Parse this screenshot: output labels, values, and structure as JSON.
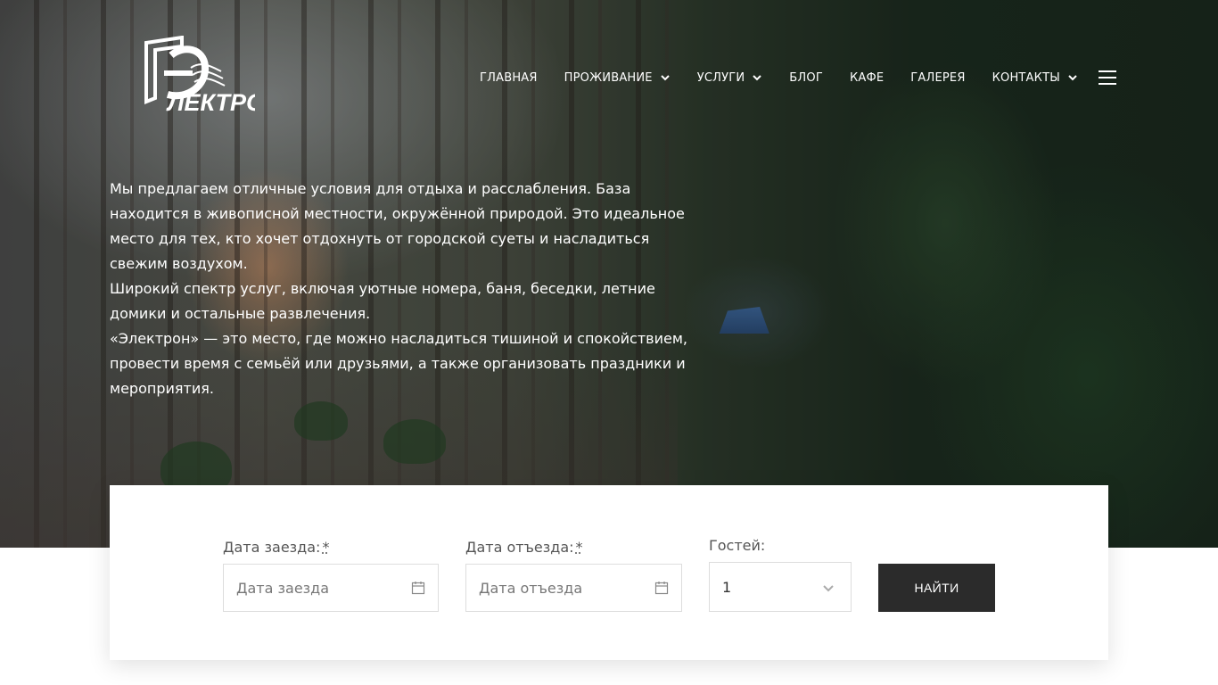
{
  "logo": {
    "text": "ЛЕКТРОН",
    "alt": "Электрон"
  },
  "nav": {
    "items": [
      {
        "label": "ГЛАВНАЯ",
        "has_dropdown": false
      },
      {
        "label": "ПРОЖИВАНИЕ",
        "has_dropdown": true
      },
      {
        "label": "УСЛУГИ",
        "has_dropdown": true
      },
      {
        "label": "БЛОГ",
        "has_dropdown": false
      },
      {
        "label": "КАФЕ",
        "has_dropdown": false
      },
      {
        "label": "ГАЛЕРЕЯ",
        "has_dropdown": false
      },
      {
        "label": "КОНТАКТЫ",
        "has_dropdown": true
      }
    ],
    "menu_icon": "hamburger-menu-icon"
  },
  "intro": {
    "paragraphs": [
      "Мы предлагаем отличные условия для отдыха и расслабления. База находится в живописной местности, окружённой природой. Это идеальное место для тех, кто хочет отдохнуть от городской суеты и насладиться свежим воздухом.",
      "Широкий спектр услуг, включая уютные номера, баня, беседки, летние домики и остальные развлечения.",
      "«Электрон» — это место, где можно насладиться тишиной и спокойствием, провести время с семьёй или друзьями, а также организовать праздники и мероприятия."
    ]
  },
  "booking": {
    "checkin": {
      "label": "Дата заезда:",
      "required_mark": "*",
      "placeholder": "Дата заезда",
      "icon": "calendar-icon"
    },
    "checkout": {
      "label": "Дата отъезда:",
      "required_mark": "*",
      "placeholder": "Дата отъезда",
      "icon": "calendar-icon"
    },
    "guests": {
      "label": "Гостей:",
      "value": "1",
      "icon": "chevron-down-icon"
    },
    "submit_label": "НАЙТИ"
  },
  "colors": {
    "button_bg": "#2b2b2b",
    "nav_text": "#ffffff",
    "label_text": "#555555",
    "input_border": "#dddddd"
  }
}
